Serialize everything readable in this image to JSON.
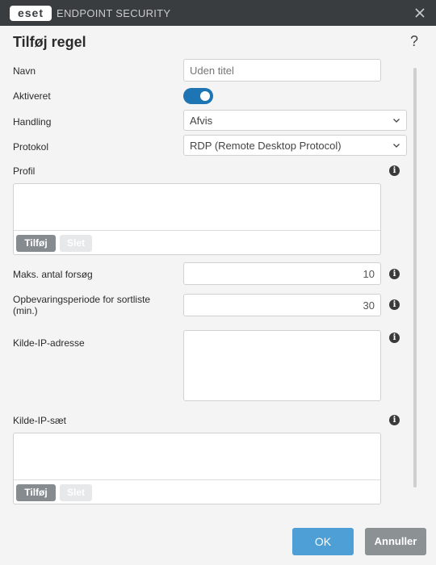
{
  "window": {
    "logo_text": "eset",
    "app_name": "ENDPOINT SECURITY"
  },
  "dialog": {
    "title": "Tilføj regel",
    "help_symbol": "?"
  },
  "form": {
    "name": {
      "label": "Navn",
      "placeholder": "Uden titel"
    },
    "enabled": {
      "label": "Aktiveret",
      "value": true
    },
    "action": {
      "label": "Handling",
      "value": "Afvis"
    },
    "protocol": {
      "label": "Protokol",
      "value": "RDP (Remote Desktop Protocol)"
    },
    "profile": {
      "label": "Profil",
      "add_label": "Tilføj",
      "delete_label": "Slet"
    },
    "max_attempts": {
      "label": "Maks. antal forsøg",
      "value": "10"
    },
    "blacklist_retention": {
      "label": "Opbevaringsperiode for sortliste (min.)",
      "value": "30"
    },
    "source_ip": {
      "label": "Kilde-IP-adresse",
      "value": ""
    },
    "source_ip_set": {
      "label": "Kilde-IP-sæt",
      "add_label": "Tilføj",
      "delete_label": "Slet"
    }
  },
  "buttons": {
    "ok": "OK",
    "cancel": "Annuller"
  },
  "colors": {
    "titlebar": "#393d40",
    "toggle_on": "#1e75b4",
    "ok_button": "#4d9fd6",
    "cancel_button": "#8c9194"
  },
  "icons": {
    "info": "info-icon",
    "dropdown": "chevron-down-icon",
    "close": "close-icon"
  }
}
